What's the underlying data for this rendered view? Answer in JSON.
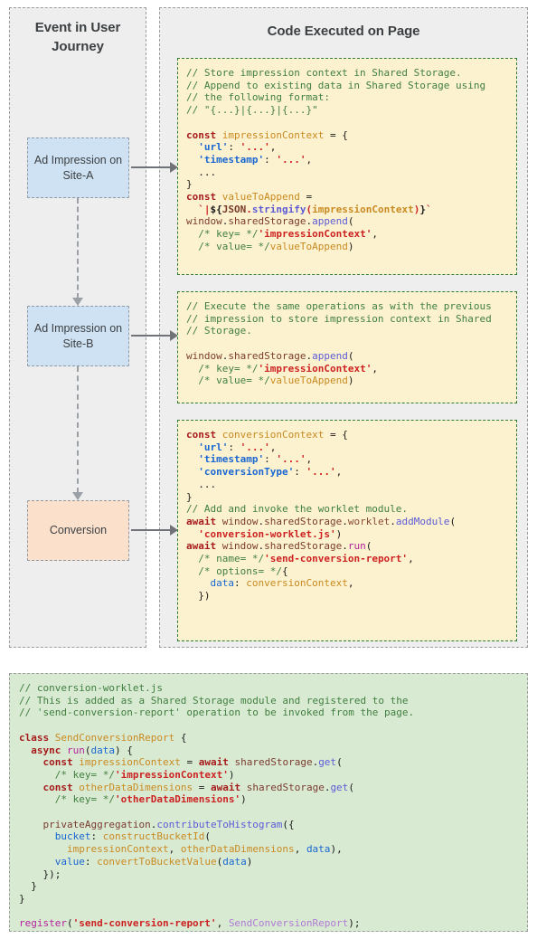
{
  "columns": {
    "left": {
      "title": "Event in User Journey"
    },
    "right": {
      "title": "Code Executed on Page"
    }
  },
  "events": [
    {
      "label": "Ad Impression on Site-A",
      "color": "#cfe2f3"
    },
    {
      "label": "Ad Impression on Site-B",
      "color": "#cfe2f3"
    },
    {
      "label": "Conversion",
      "color": "#fbe0cc"
    }
  ],
  "code_blocks": [
    {
      "id": "impression-site-a",
      "background": "#fdf2cf",
      "text": "// Store impression context in Shared Storage.\n// Append to existing data in Shared Storage using\n// the following format:\n// \"{...}|{...}|{...}\"\n\nconst impressionContext = {\n  'url': '...',\n  'timestamp': '...',\n  ...\n}\nconst valueToAppend =\n  `|${JSON.stringify(impressionContext)}`\nwindow.sharedStorage.append(\n  /* key= */'impressionContext',\n  /* value= */valueToAppend)"
    },
    {
      "id": "impression-site-b",
      "background": "#fdf2cf",
      "text": "// Execute the same operations as with the previous\n// impression to store impression context in Shared\n// Storage.\n\nwindow.sharedStorage.append(\n  /* key= */'impressionContext',\n  /* value= */valueToAppend)"
    },
    {
      "id": "conversion",
      "background": "#fdf2cf",
      "text": "const conversionContext = {\n  'url': '...',\n  'timestamp': '...',\n  'conversionType': '...',\n  ...\n}\n// Add and invoke the worklet module.\nawait window.sharedStorage.worklet.addModule(\n  'conversion-worklet.js')\nawait window.sharedStorage.run(\n  /* name= */'send-conversion-report',\n  /* options= */{\n    data: conversionContext,\n  })"
    }
  ],
  "worklet_block": {
    "id": "conversion-worklet",
    "background": "#d9ead3",
    "text": "// conversion-worklet.js\n// This is added as a Shared Storage module and registered to the\n// 'send-conversion-report' operation to be invoked from the page.\n\nclass SendConversionReport {\n  async run(data) {\n    const impressionContext = await sharedStorage.get(\n      /* key= */'impressionContext')\n    const otherDataDimensions = await sharedStorage.get(\n      /* key= */'otherDataDimensions')\n\n    privateAggregation.contributeToHistogram({\n      bucket: constructBucketId(\n        impressionContext, otherDataDimensions, data),\n      value: convertToBucketValue(data)\n    });\n  }\n}\n\nregister('send-conversion-report', SendConversionReport);"
  },
  "connectors": {
    "vertical": [
      "event-0-to-event-1",
      "event-1-to-event-2"
    ],
    "horizontal": [
      "event-0-to-code-0",
      "event-1-to-code-1",
      "event-2-to-code-2"
    ]
  },
  "palette": {
    "panel_background": "#eeeeee",
    "panel_border": "#9e9e9e",
    "impression_box": "#cfe2f3",
    "conversion_box": "#fbe0cc",
    "code_yellow": "#fdf2cf",
    "code_green": "#d9ead3",
    "code_border_green": "#2f7d32",
    "arrow": "#6f7276",
    "dashed_connector": "#9aa0a6",
    "heading_text": "#3c4043"
  }
}
